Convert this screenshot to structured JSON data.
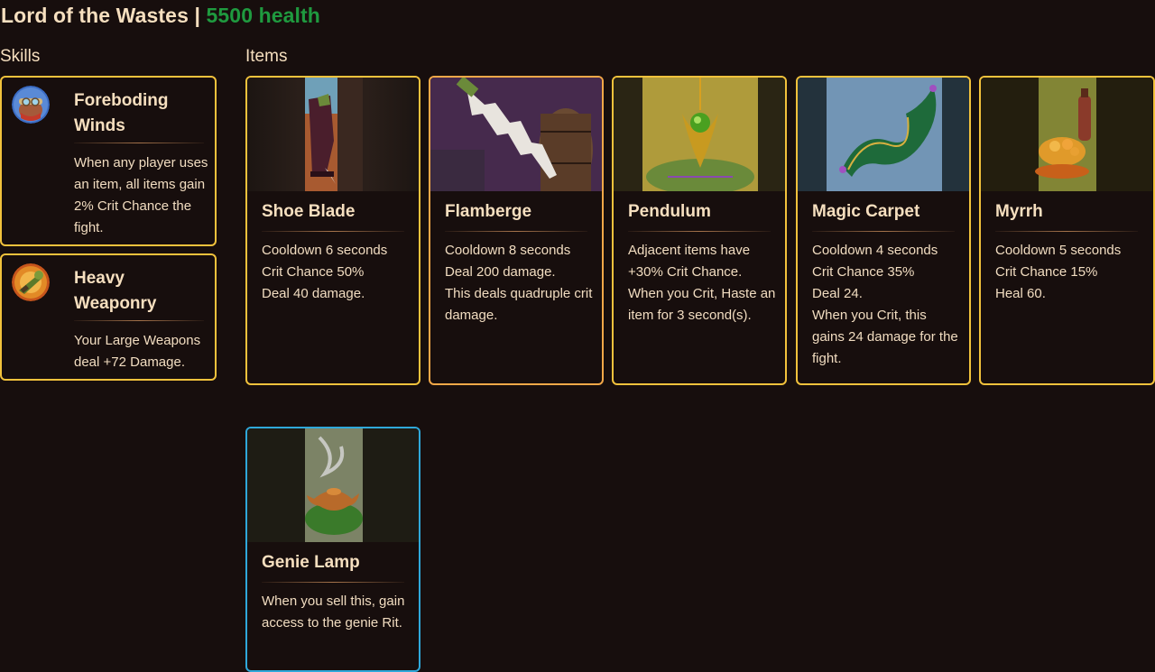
{
  "header": {
    "boss_name": "Lord of the Wastes",
    "separator": "|",
    "health": "5500 health"
  },
  "sections": {
    "skills_title": "Skills",
    "items_title": "Items"
  },
  "skills": [
    {
      "name": "Foreboding Winds",
      "description": "When any player uses an item, all items gain 2% Crit Chance the fight.",
      "icon": "foreboding-winds-portrait-icon"
    },
    {
      "name": "Heavy Weaponry",
      "description": "Your Large Weapons deal +72 Damage.",
      "icon": "heavy-weaponry-icon"
    }
  ],
  "items": [
    {
      "name": "Shoe Blade",
      "rarity_color": "#f2c23c",
      "art": "shoe-blade-art",
      "lines": [
        "Cooldown 6 seconds",
        "Crit Chance 50%",
        "Deal 40 damage."
      ]
    },
    {
      "name": "Flamberge",
      "rarity_color": "#f3a848",
      "art": "flamberge-art",
      "lines": [
        "Cooldown 8 seconds",
        "Deal 200 damage.",
        "This deals quadruple crit damage."
      ]
    },
    {
      "name": "Pendulum",
      "rarity_color": "#f2c23c",
      "art": "pendulum-art",
      "lines": [
        "Adjacent items have +30% Crit Chance.",
        "When you Crit, Haste an item for 3 second(s)."
      ]
    },
    {
      "name": "Magic Carpet",
      "rarity_color": "#f2c23c",
      "art": "magic-carpet-art",
      "lines": [
        "Cooldown 4 seconds",
        "Crit Chance 35%",
        "Deal 24.",
        "When you Crit, this gains 24 damage for the fight."
      ]
    },
    {
      "name": "Myrrh",
      "rarity_color": "#f2c23c",
      "art": "myrrh-art",
      "lines": [
        "Cooldown 5 seconds",
        "Crit Chance 15%",
        "Heal 60."
      ]
    },
    {
      "name": "Genie Lamp",
      "rarity_color": "#2fa8da",
      "art": "genie-lamp-art",
      "lines": [
        "When you sell this, gain access to the genie Rit."
      ]
    }
  ]
}
